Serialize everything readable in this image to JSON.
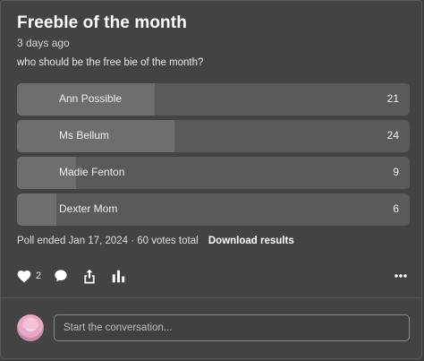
{
  "post": {
    "title": "Freeble of the month",
    "time": "3 days ago",
    "question": "who should be the free bie of the month?"
  },
  "poll": {
    "options": [
      {
        "label": "Ann Possible",
        "votes": 21,
        "count": "21"
      },
      {
        "label": "Ms Bellum",
        "votes": 24,
        "count": "24"
      },
      {
        "label": "Madie Fenton",
        "votes": 9,
        "count": "9"
      },
      {
        "label": "Dexter Mom",
        "votes": 6,
        "count": "6"
      }
    ],
    "total_votes": 60,
    "meta": "Poll ended Jan 17, 2024 · 60 votes total",
    "download_label": "Download results"
  },
  "actions": {
    "like_icon": "heart-icon",
    "like_count": "2",
    "comment_icon": "comment-bubble-icon",
    "share_icon": "share-icon",
    "stats_icon": "bar-chart-icon",
    "more_icon": "more-dots-icon"
  },
  "composer": {
    "placeholder": "Start the conversation..."
  },
  "colors": {
    "background": "#434343",
    "bar_track": "#5a5a5a",
    "bar_fill": "#6e6e6e"
  }
}
